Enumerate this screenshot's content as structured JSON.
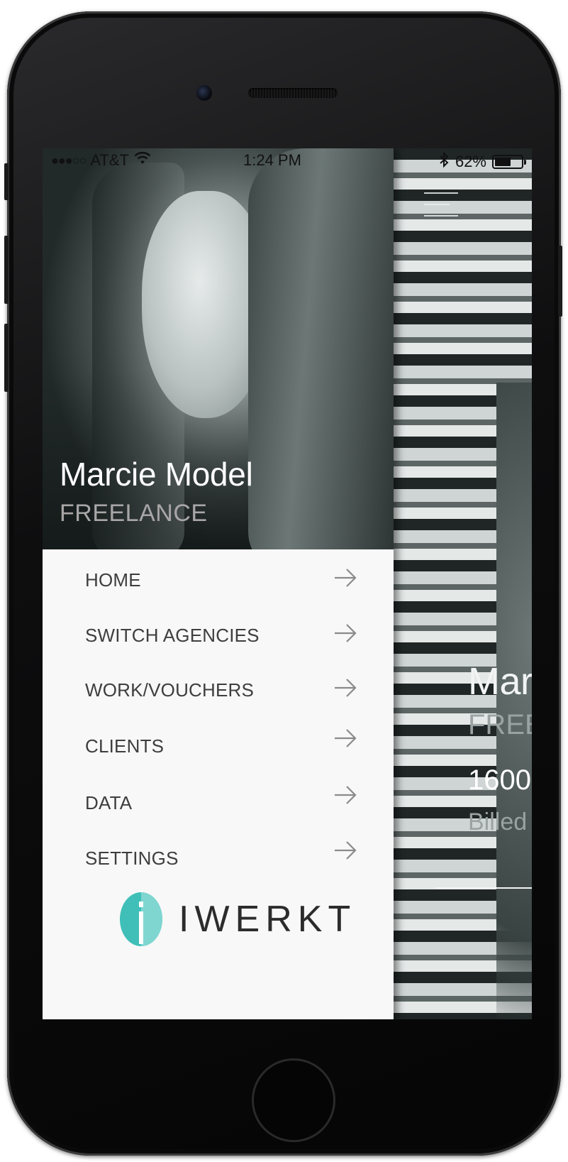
{
  "status_bar": {
    "signal": "●●●○○",
    "carrier": "AT&T",
    "time": "1:24 PM",
    "battery_percent": "62%",
    "battery_level": 0.62
  },
  "drawer": {
    "profile": {
      "name": "Marcie Model",
      "type": "FREELANCE"
    },
    "menu_items": [
      {
        "label": "HOME"
      },
      {
        "label": "SWITCH AGENCIES"
      },
      {
        "label": "WORK/VOUCHERS"
      },
      {
        "label": "CLIENTS"
      },
      {
        "label": "DATA"
      },
      {
        "label": "SETTINGS"
      }
    ],
    "brand": {
      "name": "IWERKT",
      "accent_color": "#3fbfb8"
    }
  },
  "background_app": {
    "name_partial": "Mar",
    "type_partial": "FREE",
    "amount_partial": "1600",
    "billed_partial": "Billed"
  }
}
